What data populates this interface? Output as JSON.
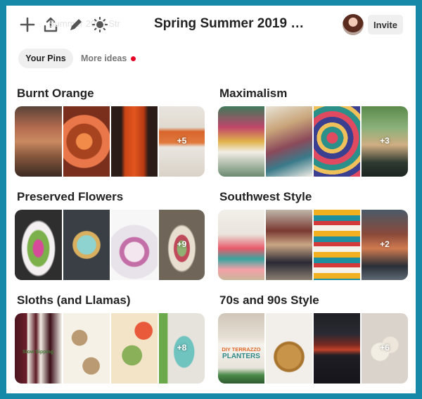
{
  "header": {
    "faded_title": "Summer 2019 Str",
    "board_title": "Spring Summer 2019 Tr...",
    "invite_label": "Invite",
    "icons": [
      "plus-icon",
      "share-icon",
      "pencil-icon",
      "sun-icon"
    ]
  },
  "tabs": {
    "your_pins": "Your Pins",
    "more_ideas": "More ideas"
  },
  "colors": {
    "frame": "#1789a8",
    "notification_dot": "#e60023",
    "button_bg": "#efefef"
  },
  "boards": [
    {
      "title": "Burnt Orange",
      "more_count": "+5"
    },
    {
      "title": "Maximalism",
      "more_count": "+3"
    },
    {
      "title": "Preserved Flowers",
      "more_count": "+9"
    },
    {
      "title": "Southwest Style",
      "more_count": "+2"
    },
    {
      "title": "Sloths (and Llamas)",
      "more_count": "+8"
    },
    {
      "title": "70s and 90s Style",
      "more_count": "+6"
    }
  ],
  "image_overlay_text": {
    "sloth_wine_label": "Slow Sipping",
    "terrazzo_text_1": "DIY TERRAZZO",
    "terrazzo_text_2": "PLANTERS"
  }
}
